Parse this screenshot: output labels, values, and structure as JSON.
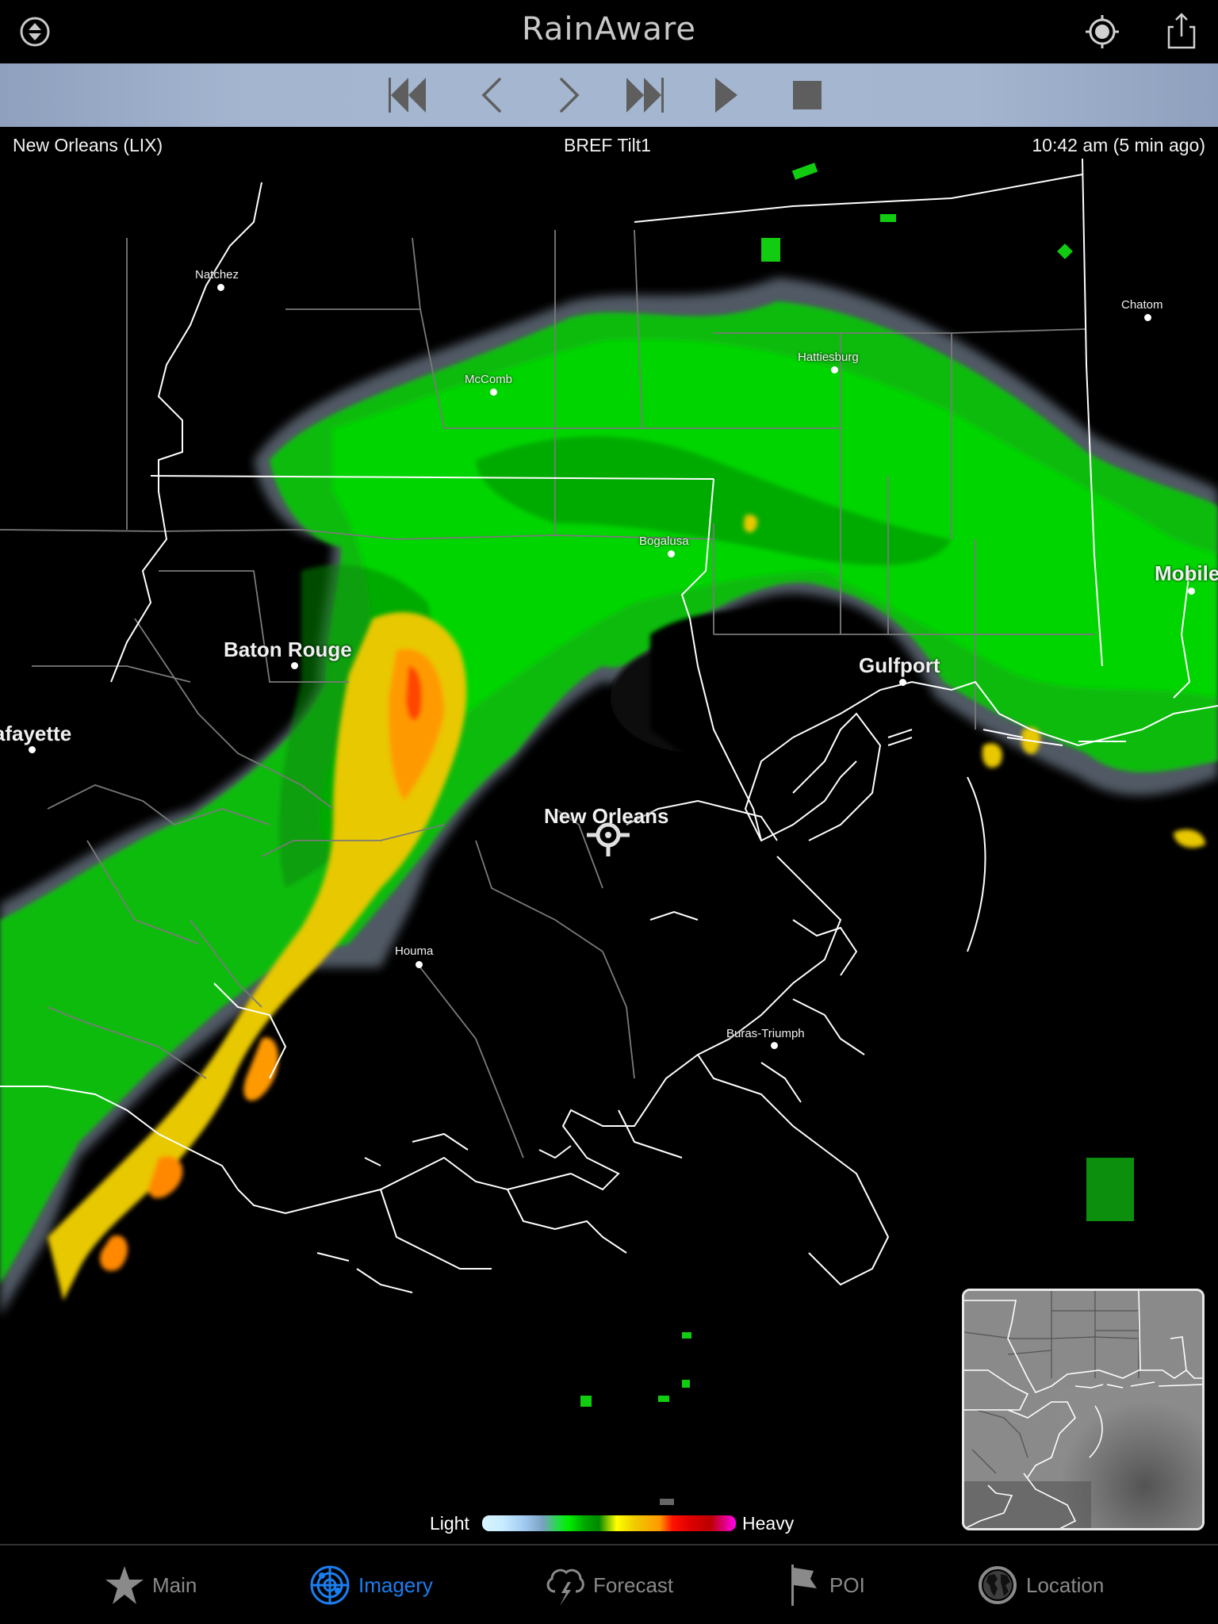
{
  "app": {
    "title": "RainAware"
  },
  "navbar": {
    "left_icon": "layer-toggle-icon",
    "right_icons": [
      "locate-icon",
      "share-icon"
    ]
  },
  "toolbar": {
    "buttons": [
      {
        "name": "skip-to-start",
        "icon": "skip-back-icon"
      },
      {
        "name": "step-back",
        "icon": "chevron-left-icon"
      },
      {
        "name": "step-forward",
        "icon": "chevron-right-icon"
      },
      {
        "name": "skip-to-end",
        "icon": "skip-forward-icon"
      },
      {
        "name": "play",
        "icon": "play-icon"
      },
      {
        "name": "stop",
        "icon": "stop-icon"
      }
    ]
  },
  "map": {
    "radar_site": "New Orleans (LIX)",
    "product": "BREF Tilt1",
    "timestamp": "10:42 am (5 min ago)",
    "cities": [
      {
        "name": "Natchez",
        "size": "small"
      },
      {
        "name": "McComb",
        "size": "small"
      },
      {
        "name": "Hattiesburg",
        "size": "small"
      },
      {
        "name": "Chatom",
        "size": "small"
      },
      {
        "name": "Bogalusa",
        "size": "small"
      },
      {
        "name": "Baton Rouge",
        "size": "big"
      },
      {
        "name": "Gulfport",
        "size": "big"
      },
      {
        "name": "Mobile",
        "size": "big"
      },
      {
        "name": "Lafayette",
        "size": "big"
      },
      {
        "name": "New Orleans",
        "size": "big"
      },
      {
        "name": "Houma",
        "size": "small"
      },
      {
        "name": "Buras-Triumph",
        "size": "small"
      }
    ],
    "colors": {
      "light_green": "#00ee00",
      "dark_green": "#008800",
      "yellow": "#ffdd00",
      "orange": "#ff9900",
      "red": "#ff3300",
      "border": "#7a7a7a",
      "coast": "#ffffff"
    }
  },
  "legend": {
    "low_label": "Light",
    "high_label": "Heavy"
  },
  "thumbnail": {
    "label": "satellite-overview"
  },
  "tabbar": {
    "active": "Imagery",
    "tabs": [
      {
        "label": "Main",
        "icon": "star-icon"
      },
      {
        "label": "Imagery",
        "icon": "radar-icon"
      },
      {
        "label": "Forecast",
        "icon": "storm-cloud-icon"
      },
      {
        "label": "POI",
        "icon": "flag-icon"
      },
      {
        "label": "Location",
        "icon": "globe-icon"
      }
    ]
  }
}
